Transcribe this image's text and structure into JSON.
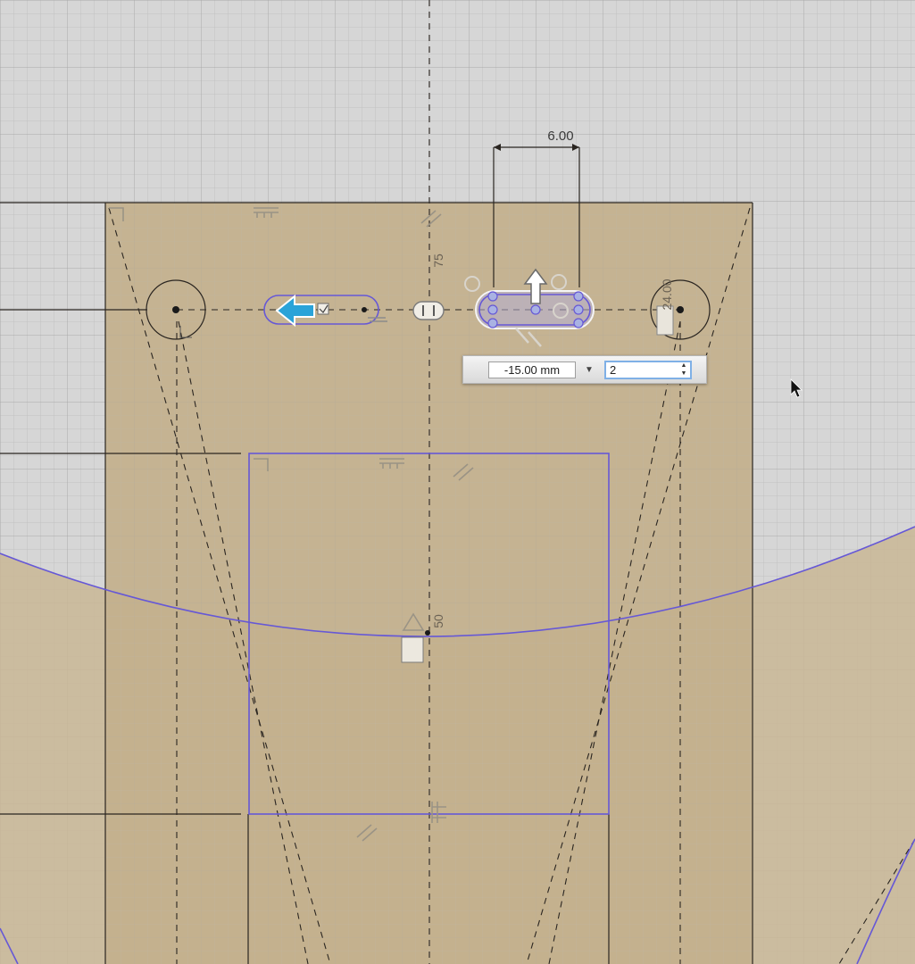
{
  "dimensions": {
    "top_width": "6.00",
    "vertical_center": "75",
    "right_vertical": "24.00",
    "mid_vertical": "50"
  },
  "pattern_input": {
    "distance_value": "-15.00 mm",
    "count_value": "2",
    "dropdown_icon": "triangle-down-icon",
    "spinner_icon": "up-down-spinner-icon"
  },
  "colors": {
    "grid_background": "#d6d6d6",
    "sketch_plane": "#c3b08c",
    "selection": "#6658d6",
    "arrow_blue": "#2aa3d8"
  }
}
